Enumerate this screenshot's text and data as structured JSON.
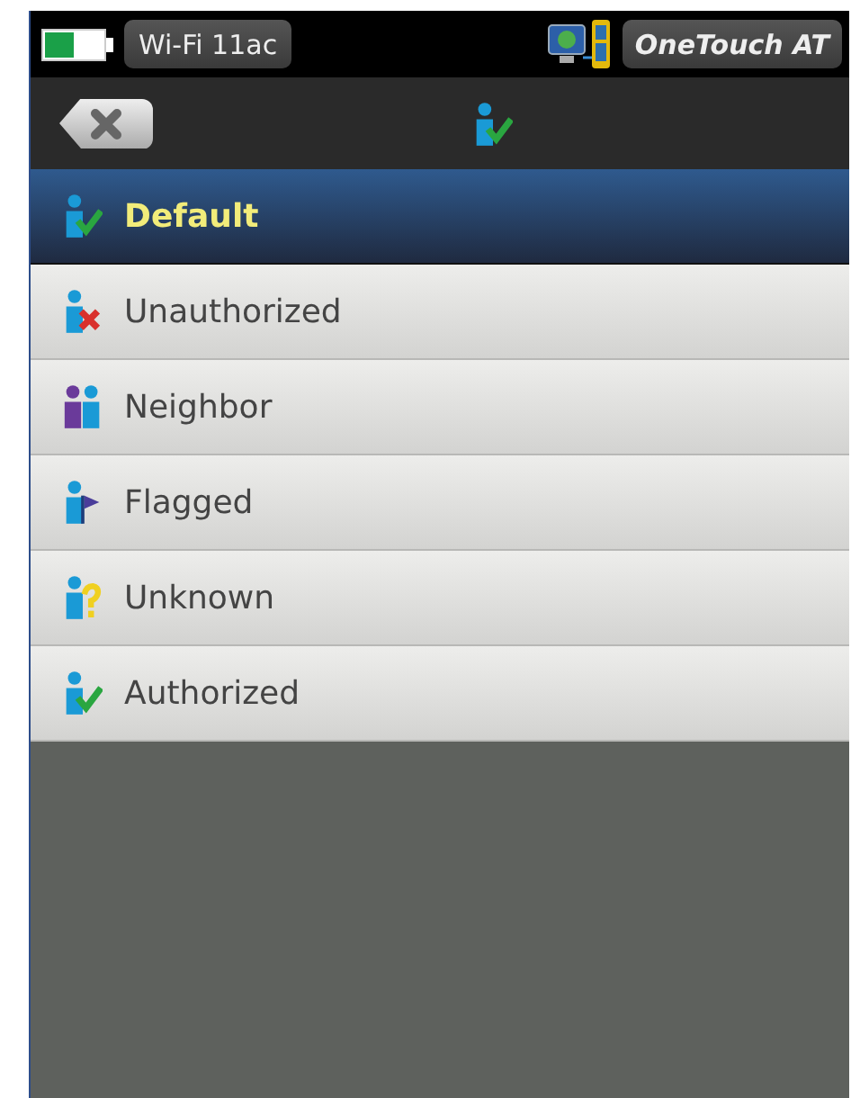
{
  "status_bar": {
    "connection": "Wi-Fi 11ac",
    "device": "OneTouch AT"
  },
  "items": [
    {
      "label": "Default",
      "kind": "check",
      "selected": true
    },
    {
      "label": "Unauthorized",
      "kind": "cross",
      "selected": false
    },
    {
      "label": "Neighbor",
      "kind": "pair",
      "selected": false
    },
    {
      "label": "Flagged",
      "kind": "flag",
      "selected": false
    },
    {
      "label": "Unknown",
      "kind": "question",
      "selected": false
    },
    {
      "label": "Authorized",
      "kind": "check",
      "selected": false
    }
  ]
}
